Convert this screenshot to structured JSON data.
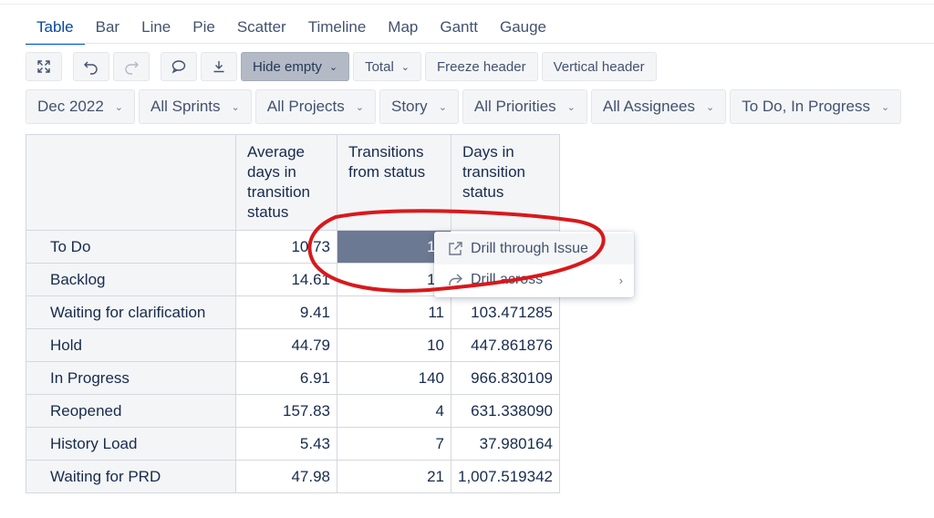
{
  "tabs": [
    "Table",
    "Bar",
    "Line",
    "Pie",
    "Scatter",
    "Timeline",
    "Map",
    "Gantt",
    "Gauge"
  ],
  "toolbar": {
    "icons": [
      "fullscreen-icon",
      "undo-icon",
      "redo-icon",
      "comment-icon",
      "download-icon"
    ],
    "hide_empty": "Hide empty",
    "total": "Total",
    "freeze_header": "Freeze header",
    "vertical_header": "Vertical header"
  },
  "filters": [
    "Dec 2022",
    "All Sprints",
    "All Projects",
    "Story",
    "All Priorities",
    "All Assignees",
    "To Do, In Progress"
  ],
  "table": {
    "columns": [
      "Average days in transition status",
      "Transitions from status",
      "Days in transition status"
    ],
    "rows": [
      {
        "label": "To Do",
        "avg": "10.73",
        "transitions": "10",
        "days": ""
      },
      {
        "label": "Backlog",
        "avg": "14.61",
        "transitions": "15",
        "days": ""
      },
      {
        "label": "Waiting for clarification",
        "avg": "9.41",
        "transitions": "11",
        "days": "103.471285"
      },
      {
        "label": "Hold",
        "avg": "44.79",
        "transitions": "10",
        "days": "447.861876"
      },
      {
        "label": "In Progress",
        "avg": "6.91",
        "transitions": "140",
        "days": "966.830109"
      },
      {
        "label": "Reopened",
        "avg": "157.83",
        "transitions": "4",
        "days": "631.338090"
      },
      {
        "label": "History Load",
        "avg": "5.43",
        "transitions": "7",
        "days": "37.980164"
      },
      {
        "label": "Waiting for PRD",
        "avg": "47.98",
        "transitions": "21",
        "days": "1,007.519342"
      }
    ]
  },
  "context_menu": {
    "items": [
      {
        "label": "Drill through Issue",
        "icon": "external-link-icon"
      },
      {
        "label": "Drill across",
        "icon": "share-arrow-icon"
      }
    ]
  },
  "annotation_color": "#d7191c"
}
